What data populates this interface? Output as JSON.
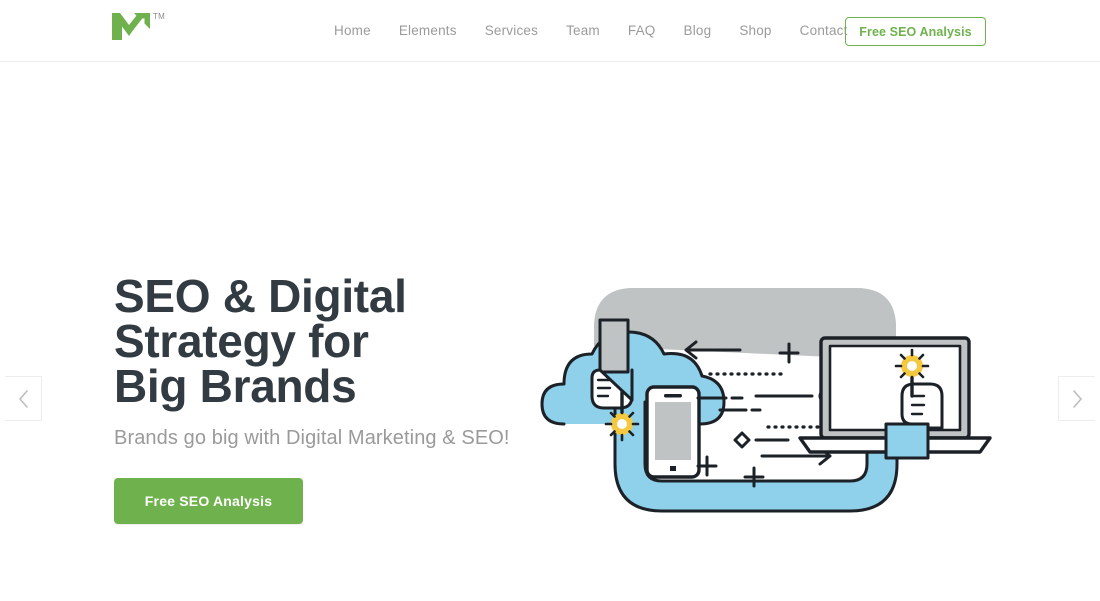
{
  "header": {
    "logo": {
      "name": "brand-logo",
      "icon": "m-arrow-logo-icon",
      "color": "#6fb24d",
      "trademark": "TM"
    },
    "nav_items": [
      {
        "label": "Home"
      },
      {
        "label": "Elements"
      },
      {
        "label": "Services"
      },
      {
        "label": "Team"
      },
      {
        "label": "FAQ"
      },
      {
        "label": "Blog"
      },
      {
        "label": "Shop"
      },
      {
        "label": "Contact"
      }
    ],
    "cta_label": "Free SEO Analysis"
  },
  "hero": {
    "title": "SEO & Digital\nStrategy for\nBig Brands",
    "subtitle": "Brands go big with Digital Marketing & SEO!",
    "cta_label": "Free SEO Analysis",
    "illustration": {
      "name": "seo-devices-illustration",
      "elements": [
        "cloud",
        "gray-pipe",
        "blue-pipe",
        "pointing-hand-cloud",
        "gear-burst-cloud",
        "smartphone",
        "laptop",
        "pointing-hand-laptop",
        "gear-burst-laptop",
        "arrow-left",
        "arrow-right",
        "dotted-lines",
        "dashes",
        "plus-signs",
        "circle",
        "diamond"
      ]
    }
  },
  "carousel": {
    "prev_label": "‹",
    "next_label": "›"
  },
  "colors": {
    "brand_green": "#6fb24d",
    "heading": "#323a42",
    "body_text": "#9a9a9a",
    "nav_text": "#9b9b9b",
    "cloud_blue": "#8fd0ea",
    "pipe_gray": "#bfc3c4",
    "line_dark": "#1b2127",
    "burst_yellow": "#f5c93f"
  }
}
